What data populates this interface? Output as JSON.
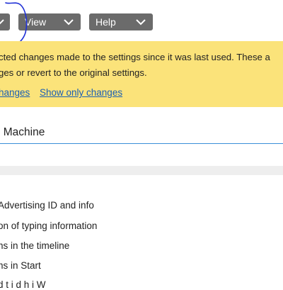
{
  "toolbar": {
    "view_label": "View",
    "help_label": "Help"
  },
  "banner": {
    "line1": "cted changes made to the settings since it was last used. These a",
    "line2": "ges or revert to the original settings.",
    "link_all": "hanges",
    "link_show": "Show only changes"
  },
  "section": {
    "title": "l Machine"
  },
  "items": [
    "Advertising ID and info",
    "on of typing information",
    "ns in the timeline",
    "ns in Start",
    "                    d  t     i            d     h   i    W"
  ],
  "colors": {
    "button_bg": "#6b6b6b",
    "banner_bg": "#fbe37a",
    "link": "#1a5fb4",
    "accent_underline": "#3a8fd8",
    "annotation_pen": "#1e2fd6"
  }
}
